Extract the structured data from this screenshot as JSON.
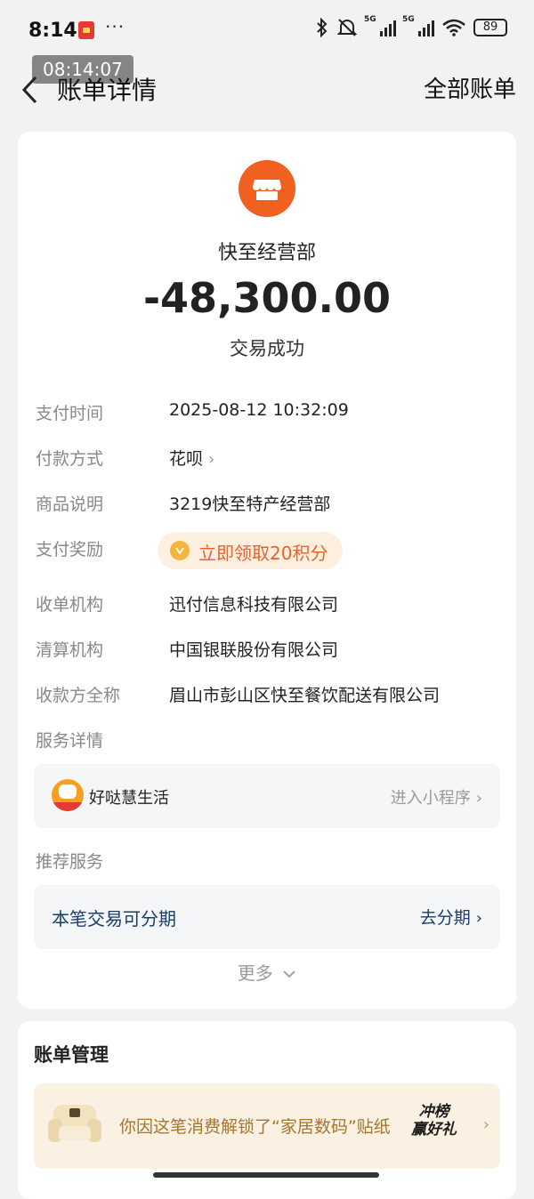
{
  "status_bar": {
    "time": "8:14",
    "more": "···",
    "network_1": "5G",
    "network_2": "5G",
    "battery": "89"
  },
  "timestamp_overlay": "08:14:07",
  "nav": {
    "title": "账单详情",
    "right_link": "全部账单"
  },
  "transaction": {
    "merchant": "快至经营部",
    "amount": "-48,300.00",
    "status": "交易成功"
  },
  "details": {
    "pay_time_label": "支付时间",
    "pay_time_value": "2025-08-12 10:32:09",
    "pay_method_label": "付款方式",
    "pay_method_value": "花呗",
    "product_label": "商品说明",
    "product_value": "3219快至特产经营部",
    "reward_label": "支付奖励",
    "reward_value": "立即领取20积分",
    "acquirer_label": "收单机构",
    "acquirer_value": "迅付信息科技有限公司",
    "clearing_label": "清算机构",
    "clearing_value": "中国银联股份有限公司",
    "payee_label": "收款方全称",
    "payee_value": "眉山市彭山区快至餐饮配送有限公司"
  },
  "service": {
    "section_label": "服务详情",
    "miniapp_name": "好哒慧生活",
    "miniapp_link": "进入小程序"
  },
  "recommend": {
    "section_label": "推荐服务",
    "installment_title": "本笔交易可分期",
    "installment_link": "去分期"
  },
  "more_label": "更多",
  "bill_management": {
    "title": "账单管理",
    "banner_text": "你因这笔消费解锁了“家居数码”贴纸",
    "badge_line1": "冲榜",
    "badge_line2": "赢好礼"
  },
  "colors": {
    "accent_orange": "#f0601e",
    "reward_text": "#e8632c",
    "link_blue": "#1a3d6b"
  }
}
